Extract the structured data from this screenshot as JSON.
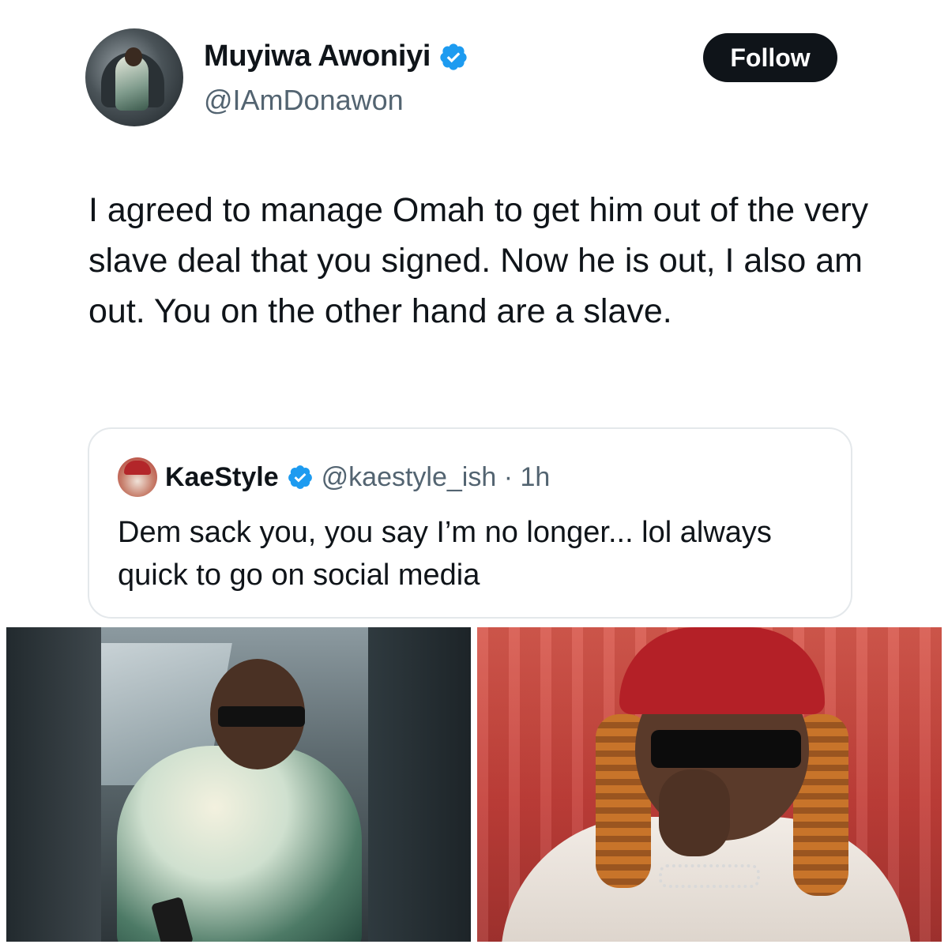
{
  "author": {
    "display_name": "Muyiwa Awoniyi",
    "handle": "@IAmDonawon",
    "verified": true
  },
  "follow_button": {
    "label": "Follow"
  },
  "tweet": {
    "text": "I agreed to manage Omah to get him out of the very slave deal that you signed. Now he is out, I also am out. You on the other hand are a slave."
  },
  "quote": {
    "display_name": "KaeStyle",
    "handle_time": "@kaestyle_ish · 1h",
    "verified": true,
    "text": "Dem sack you, you say I’m no longer... lol always quick to go on social media"
  },
  "colors": {
    "verified_badge": "#1d9bf0",
    "follow_bg": "#0f1419",
    "secondary_text": "#536471",
    "card_border": "#e4e8eb"
  },
  "icons": {
    "verified": "verified-badge-icon"
  }
}
